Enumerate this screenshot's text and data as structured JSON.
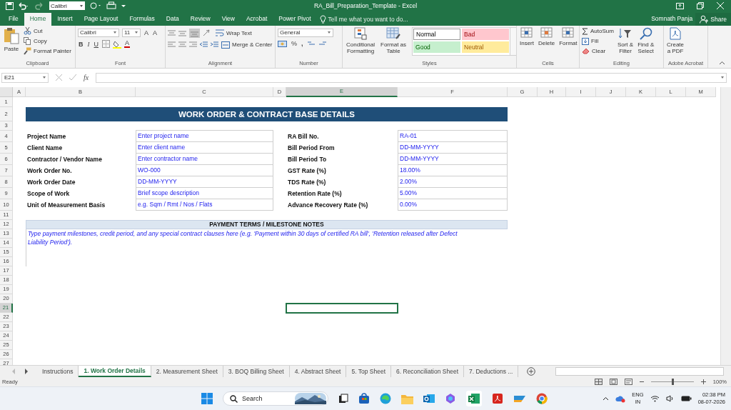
{
  "window": {
    "title": "RA_Bill_Preparation_Template - Excel",
    "user": "Somnath Panja",
    "share": "Share"
  },
  "quick_access": {
    "font": "Calibri"
  },
  "ribbon_tabs": [
    {
      "label": "File",
      "selected": false
    },
    {
      "label": "Home",
      "selected": true
    },
    {
      "label": "Insert",
      "selected": false
    },
    {
      "label": "Page Layout",
      "selected": false
    },
    {
      "label": "Formulas",
      "selected": false
    },
    {
      "label": "Data",
      "selected": false
    },
    {
      "label": "Review",
      "selected": false
    },
    {
      "label": "View",
      "selected": false
    },
    {
      "label": "Acrobat",
      "selected": false
    },
    {
      "label": "Power Pivot",
      "selected": false
    }
  ],
  "tell_me": {
    "placeholder": "Tell me what you want to do..."
  },
  "clipboard": {
    "label": "Clipboard",
    "paste": "Paste",
    "cut": "Cut",
    "copy": "Copy",
    "format_painter": "Format Painter"
  },
  "font": {
    "label": "Font",
    "family": "Calibri",
    "size": "11",
    "grow": "A",
    "shrink": "A",
    "bold": "B",
    "italic": "I",
    "underline": "U",
    "font_color": "A"
  },
  "alignment": {
    "label": "Alignment",
    "wrap_text": "Wrap Text",
    "merge_center": "Merge & Center"
  },
  "number": {
    "label": "Number",
    "format": "General",
    "percent": "%",
    "comma": ","
  },
  "styles": {
    "label": "Styles",
    "conditional_formatting": [
      "Conditional",
      "Formatting"
    ],
    "format_as_table": [
      "Format as",
      "Table"
    ],
    "cell_styles": [
      {
        "label": "Normal",
        "color": "#ffffff"
      },
      {
        "label": "Bad",
        "color": "#ffc7ce"
      },
      {
        "label": "Good",
        "color": "#c6efce"
      },
      {
        "label": "Neutral",
        "color": "#ffeb9c"
      }
    ]
  },
  "cells": {
    "label": "Cells",
    "buttons": [
      "Insert",
      "Delete",
      "Format"
    ]
  },
  "editing": {
    "label": "Editing",
    "autosum": "AutoSum",
    "fill": "Fill",
    "clear": "Clear",
    "sort_filter": [
      "Sort &",
      "Filter"
    ],
    "find_select": [
      "Find &",
      "Select"
    ]
  },
  "acrobat": {
    "label": "Adobe Acrobat",
    "create_pdf": [
      "Create",
      "a PDF"
    ]
  },
  "formula_bar": {
    "name_box": "E21",
    "fx": "fx"
  },
  "columns": [
    {
      "label": "A",
      "selected": false
    },
    {
      "label": "B",
      "selected": false
    },
    {
      "label": "C",
      "selected": false
    },
    {
      "label": "D",
      "selected": false
    },
    {
      "label": "E",
      "selected": true
    },
    {
      "label": "F",
      "selected": false
    },
    {
      "label": "G",
      "selected": false
    },
    {
      "label": "H",
      "selected": false
    },
    {
      "label": "I",
      "selected": false
    },
    {
      "label": "J",
      "selected": false
    },
    {
      "label": "K",
      "selected": false
    },
    {
      "label": "L",
      "selected": false
    },
    {
      "label": "M",
      "selected": false
    }
  ],
  "rows": [
    {
      "label": "1",
      "selected": false
    },
    {
      "label": "2",
      "selected": false
    },
    {
      "label": "3",
      "selected": false
    },
    {
      "label": "4",
      "selected": false
    },
    {
      "label": "5",
      "selected": false
    },
    {
      "label": "6",
      "selected": false
    },
    {
      "label": "7",
      "selected": false
    },
    {
      "label": "8",
      "selected": false
    },
    {
      "label": "9",
      "selected": false
    },
    {
      "label": "10",
      "selected": false
    },
    {
      "label": "11",
      "selected": false
    },
    {
      "label": "12",
      "selected": false
    },
    {
      "label": "13",
      "selected": false
    },
    {
      "label": "14",
      "selected": false
    },
    {
      "label": "15",
      "selected": false
    },
    {
      "label": "16",
      "selected": false
    },
    {
      "label": "17",
      "selected": false
    },
    {
      "label": "18",
      "selected": false
    },
    {
      "label": "19",
      "selected": false
    },
    {
      "label": "20",
      "selected": false
    },
    {
      "label": "21",
      "selected": true
    },
    {
      "label": "22",
      "selected": false
    },
    {
      "label": "23",
      "selected": false
    },
    {
      "label": "24",
      "selected": false
    },
    {
      "label": "25",
      "selected": false
    },
    {
      "label": "26",
      "selected": false
    },
    {
      "label": "27",
      "selected": false
    }
  ],
  "sheet": {
    "title": "WORK ORDER & CONTRACT BASE DETAILS",
    "left_fields": [
      {
        "label": "Project Name",
        "value": "Enter project name"
      },
      {
        "label": "Client Name",
        "value": "Enter client name"
      },
      {
        "label": "Contractor / Vendor Name",
        "value": "Enter contractor name"
      },
      {
        "label": "Work Order No.",
        "value": "WO-000"
      },
      {
        "label": "Work Order Date",
        "value": "DD-MM-YYYY"
      },
      {
        "label": "Scope of Work",
        "value": "Brief scope description"
      },
      {
        "label": "Unit of Measurement Basis",
        "value": "e.g. Sqm / Rmt / Nos / Flats"
      }
    ],
    "right_fields": [
      {
        "label": "RA Bill No.",
        "value": "RA-01"
      },
      {
        "label": "Bill Period From",
        "value": "DD-MM-YYYY"
      },
      {
        "label": "Bill Period To",
        "value": "DD-MM-YYYY"
      },
      {
        "label": "GST Rate (%)",
        "value": "18.00%"
      },
      {
        "label": "TDS Rate (%)",
        "value": "2.00%"
      },
      {
        "label": "Retention Rate (%)",
        "value": "5.00%"
      },
      {
        "label": "Advance Recovery Rate (%)",
        "value": "0.00%"
      }
    ],
    "notes_header": "PAYMENT TERMS / MILESTONE NOTES",
    "notes": "Type payment milestones, credit period, and any special contract clauses here (e.g. 'Payment within 30 days of certified RA bill', 'Retention released after Defect Liability Period')."
  },
  "sheet_tabs": [
    {
      "label": "Instructions",
      "selected": false
    },
    {
      "label": "1. Work Order Details",
      "selected": true
    },
    {
      "label": "2. Measurement Sheet",
      "selected": false
    },
    {
      "label": "3. BOQ Billing Sheet",
      "selected": false
    },
    {
      "label": "4. Abstract Sheet",
      "selected": false
    },
    {
      "label": "5. Top Sheet",
      "selected": false
    },
    {
      "label": "6. Reconciliation Sheet",
      "selected": false
    },
    {
      "label": "7. Deductions ...",
      "selected": false
    }
  ],
  "status_bar": {
    "status": "Ready",
    "zoom": "100%",
    "zoom_slider": {
      "level": 0.5
    }
  },
  "taskbar": {
    "search": "Search",
    "language": "ENG",
    "region": "IN",
    "time": "02:38 PM",
    "date": "08-07-2026"
  }
}
